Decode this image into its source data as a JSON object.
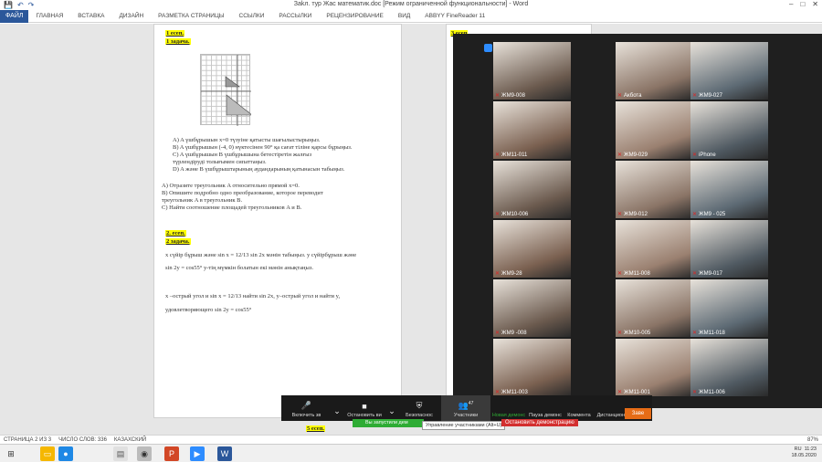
{
  "word": {
    "title": "Заkл. тур Жас математик.doc [Режим ограниченной функциональности] - Word",
    "tabs": [
      "ГЛАВНАЯ",
      "ВСТАВКА",
      "ДИЗАЙН",
      "РАЗМЕТКА СТРАНИЦЫ",
      "ССЫЛКИ",
      "РАССЫЛКИ",
      "РЕЦЕНЗИРОВАНИЕ",
      "ВИД",
      "ABBYY FineReader 11"
    ],
    "file_tab": "ФАЙЛ",
    "status": {
      "page": "СТРАНИЦА 2 ИЗ 3",
      "words": "ЧИСЛО СЛОВ: 336",
      "lang": "КАЗАХСКИЙ",
      "zoom": "87%"
    }
  },
  "doc": {
    "s1_head": "1 есеп.",
    "s1_task": "1 задача.",
    "kz_lines": [
      "A) A үшбұрышын x=0 түзуіне қатысты шағылыстырыңыз.",
      "B) A үшбұрышын (-4, 0) нүктесінен 90° қа сағат тіліне қарсы бұрыңыз.",
      "C) A үшбұрышын B үшбұрышына бетестіретін жалғыз",
      "    түрлендіруді толығымен сипаттаңыз.",
      "D) A және B үшбұрыштарының аудандарының қатынасын табыңыз."
    ],
    "ru_lines": [
      "A)   Отразите треугольник A относительно прямой  x=0.",
      "B)   Опишите подробно одно преобразование, которое переводит",
      "      треугольник A в треугольник B.",
      "C)  Найти соотношение площадей треугольников A и B."
    ],
    "s2_head": "2. есеп.",
    "s2_task": "2 задача.",
    "s2_kz1": "x сүйір бұрыш және  sin x = 12/13  sin 2x мәнін табыңыз. y сүйірбұрыш және",
    "s2_kz2": "sin 2y = cos55°  y-тің мүмкін болатын екі мәнін анықтаңыз.",
    "s2_ru1": "x –острый угол и  sin x = 12/13  найти sin 2x, y–острый угол и  найти y,",
    "s2_ru2": "удовлетворяющего  sin 2y = cos55°",
    "s5_head": "5 есеп.",
    "p2_head": "3 есеп"
  },
  "zoom": {
    "participants": [
      "ЖМ9-008",
      "Акбота",
      "ЖМ9-027",
      "ЖМ11-011",
      "ЖМ9-029",
      "iPhone",
      "ЖМ10-006",
      "ЖМ9-012",
      "ЖМ9 - 025",
      "ЖМ9-28",
      "ЖМ11-008",
      "ЖМ9-017",
      "ЖМ9 -008",
      "ЖМ10-005",
      "ЖМ11-018",
      "ЖМ11-003",
      "ЖМ11-001",
      "ЖМ11-006"
    ],
    "toolbar": {
      "unmute": "Включить зв",
      "video": "Остановить ви",
      "security": "Безопаснос",
      "participants": "Участники",
      "participants_count": "47",
      "new_share": "Новая демонс",
      "pause_share": "Пауза демонс",
      "annotate": "Коммента",
      "remote": "Дистанционное уп",
      "end": "Заве",
      "tooltip": "Управление участниками (Alt+U)",
      "stop_share": "Остановить демонстрацию",
      "sharing_note": "Вы запустили дем"
    }
  },
  "taskbar": {
    "lang": "RU",
    "time": "11:23",
    "date": "18.05.2020"
  }
}
